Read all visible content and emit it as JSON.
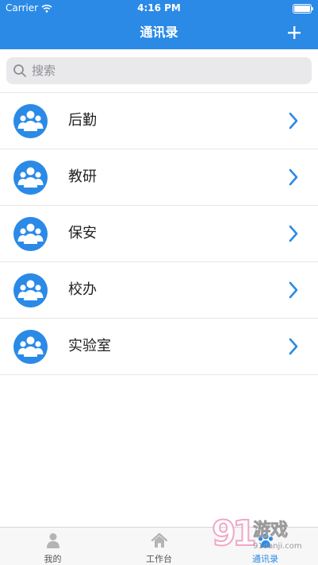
{
  "status_bar": {
    "carrier": "Carrier",
    "time": "4:16 PM",
    "battery_level": 1.0
  },
  "nav": {
    "title": "通讯录",
    "add_icon": "plus-icon"
  },
  "search": {
    "placeholder": "搜索",
    "icon": "search-icon"
  },
  "groups": [
    {
      "name": "后勤",
      "icon": "group-icon"
    },
    {
      "name": "教研",
      "icon": "group-icon"
    },
    {
      "name": "保安",
      "icon": "group-icon"
    },
    {
      "name": "校办",
      "icon": "group-icon"
    },
    {
      "name": "实验室",
      "icon": "group-icon"
    }
  ],
  "tabs": [
    {
      "label": "我的",
      "icon": "person-icon",
      "active": false
    },
    {
      "label": "工作台",
      "icon": "home-icon",
      "active": false
    },
    {
      "label": "通讯录",
      "icon": "contacts-icon",
      "active": true
    }
  ],
  "watermark": {
    "brand": "91游戏",
    "site": "91danji.com"
  },
  "colors": {
    "primary": "#2a8ae6",
    "separator": "#e6e6e6",
    "search_bg": "#e9e9ec",
    "tab_bg": "#f7f7f7"
  }
}
